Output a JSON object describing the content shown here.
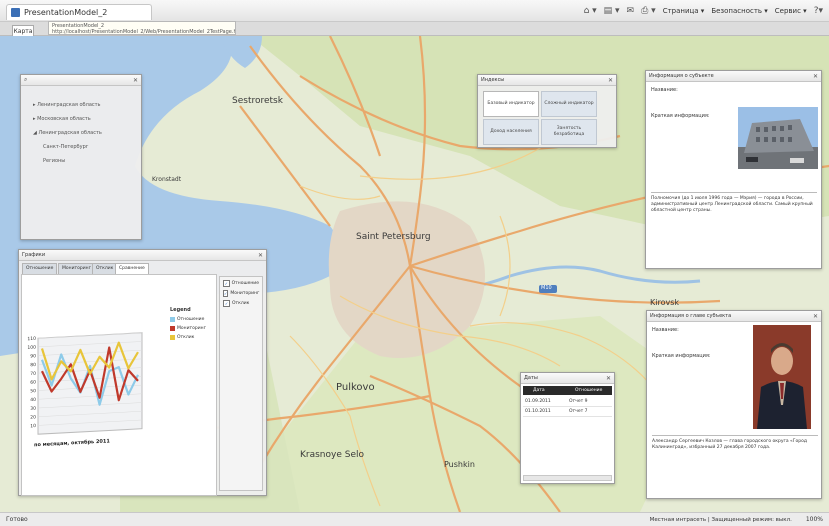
{
  "browser": {
    "tab_title": "PresentationModel_2",
    "tooltip_line1": "PresentationModel_2",
    "tooltip_line2": "http://localhost/PresentationModel_2/Web/PresentationModel_2TestPage.html",
    "menu": [
      "Страница ▾",
      "Безопасность ▾",
      "Сервис ▾"
    ]
  },
  "map_tab": "Карта",
  "places": {
    "sestroretsk": "Sestroretsk",
    "kronstadt": "Kronstadt",
    "saint_petersburg": "Saint Petersburg",
    "pulkovo": "Pulkovo",
    "krasnoye_selo": "Krasnoye Selo",
    "pushkin": "Pushkin",
    "kirovsk": "Kirovsk",
    "road_badge": "M10"
  },
  "tree_panel": {
    "items": [
      "Ленинградская область",
      "Московская область",
      "Ленинградская область",
      "Санкт-Петербург",
      "Регионы"
    ]
  },
  "indicators_panel": {
    "title": "Индексы",
    "buttons": [
      "Базовый индикатор",
      "Сложный индикатор",
      "Доход населения",
      "Занятость безработица"
    ]
  },
  "info_subject": {
    "title": "Информация о субъекте",
    "label_name": "Название:",
    "label_brief": "Краткая информация:",
    "description": "Полномочия (до 1 июля 1996 года — Мэрия) — города в России, административный центр Ленинградской области. Самый крупный областной центр страны."
  },
  "info_head": {
    "title": "Информация о главе субъекта",
    "label_name": "Название:",
    "label_brief": "Краткая информация:",
    "description": "Александр Сергеевич Козлов — глава городского округа «Город Калининград», избранный 27 декабря 2007 года."
  },
  "charts_panel": {
    "title": "Графики",
    "tabs": [
      "Отношение",
      "Мониторинг",
      "Отклик",
      "Сравнение"
    ],
    "legend_title": "Legend",
    "series_names": [
      "Отношение",
      "Мониторинг",
      "Отклик"
    ],
    "checkboxes": [
      "Отношение",
      "Мониторинг",
      "Отклик"
    ],
    "axis_caption": "по месяцам, октябрь 2011",
    "y_ticks": [
      "110",
      "100",
      "90",
      "80",
      "70",
      "60",
      "50",
      "40",
      "30",
      "20",
      "10"
    ]
  },
  "chart_data": {
    "type": "line",
    "title": "",
    "ylim": [
      0,
      110
    ],
    "x": [
      1,
      2,
      3,
      4,
      5,
      6,
      7,
      8,
      9,
      10,
      11
    ],
    "series": [
      {
        "name": "Отношение",
        "color": "#8ecbe9",
        "values": [
          85,
          55,
          90,
          62,
          45,
          75,
          30,
          68,
          72,
          40,
          62
        ]
      },
      {
        "name": "Мониторинг",
        "color": "#c0392b",
        "values": [
          72,
          48,
          62,
          78,
          46,
          70,
          38,
          95,
          34,
          68,
          55
        ]
      },
      {
        "name": "Отклик",
        "color": "#e8c53a",
        "values": [
          98,
          62,
          82,
          70,
          94,
          66,
          85,
          72,
          100,
          70,
          88
        ]
      }
    ]
  },
  "list_panel": {
    "title": "Даты",
    "col_date": "Дата",
    "col_event": "Отношение",
    "rows": [
      {
        "date": "01.09.2011",
        "event": "Отчет 9"
      },
      {
        "date": "01.10.2011",
        "event": "Отчет 7"
      }
    ]
  },
  "status": {
    "left": "Готово",
    "zone": "Местная интрасеть | Защищенный режим: выкл.",
    "zoom": "100%"
  }
}
